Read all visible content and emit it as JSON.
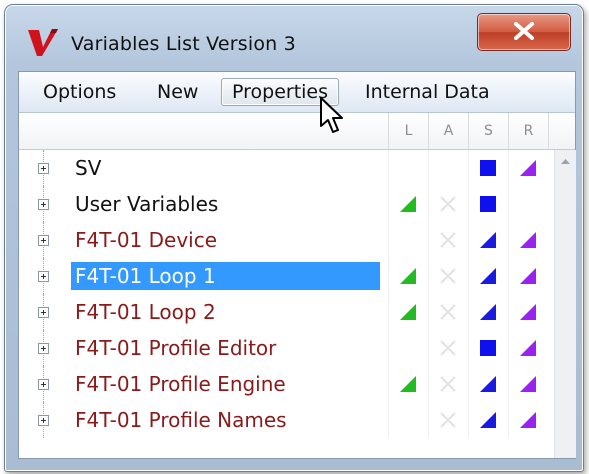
{
  "window": {
    "title": "Variables List Version 3",
    "close_label": "X"
  },
  "menu": {
    "items": [
      "Options",
      "New",
      "Properties",
      "Internal Data"
    ],
    "open_index": 2
  },
  "columns": {
    "headers": [
      "L",
      "A",
      "S",
      "R"
    ]
  },
  "icons": {
    "app": "v-logo-icon",
    "close": "close-icon",
    "expander": "plus-box-icon",
    "cursor": "mouse-pointer-icon",
    "scroll_up": "scroll-up-arrow-icon"
  },
  "colors": {
    "root_text": "#111111",
    "device_text": "#8b1a1a",
    "selection": "#3399ff",
    "L_marker": "#22bb22",
    "S_square": "#1010ee",
    "S_triangle": "#1a1ae0",
    "R_triangle": "#9922ee",
    "A_disabled": "#e3e3e3"
  },
  "rows": [
    {
      "label": "SV",
      "kind": "root",
      "L": "",
      "A": false,
      "S": "square",
      "R": "triangle"
    },
    {
      "label": "User Variables",
      "kind": "root",
      "L": "triangle",
      "A": true,
      "S": "square",
      "R": ""
    },
    {
      "label": "F4T-01 Device",
      "kind": "device",
      "L": "",
      "A": true,
      "S": "triangle",
      "R": "triangle"
    },
    {
      "label": "F4T-01 Loop 1",
      "kind": "device",
      "selected": true,
      "L": "triangle",
      "A": true,
      "S": "triangle",
      "R": "triangle"
    },
    {
      "label": "F4T-01 Loop 2",
      "kind": "device",
      "L": "triangle",
      "A": true,
      "S": "triangle",
      "R": "triangle"
    },
    {
      "label": "F4T-01 Profile Editor",
      "kind": "device",
      "L": "",
      "A": true,
      "S": "square",
      "R": "triangle"
    },
    {
      "label": "F4T-01 Profile Engine",
      "kind": "device",
      "L": "triangle",
      "A": true,
      "S": "triangle",
      "R": "triangle"
    },
    {
      "label": "F4T-01 Profile Names",
      "kind": "device",
      "L": "",
      "A": true,
      "S": "triangle",
      "R": "triangle"
    }
  ]
}
